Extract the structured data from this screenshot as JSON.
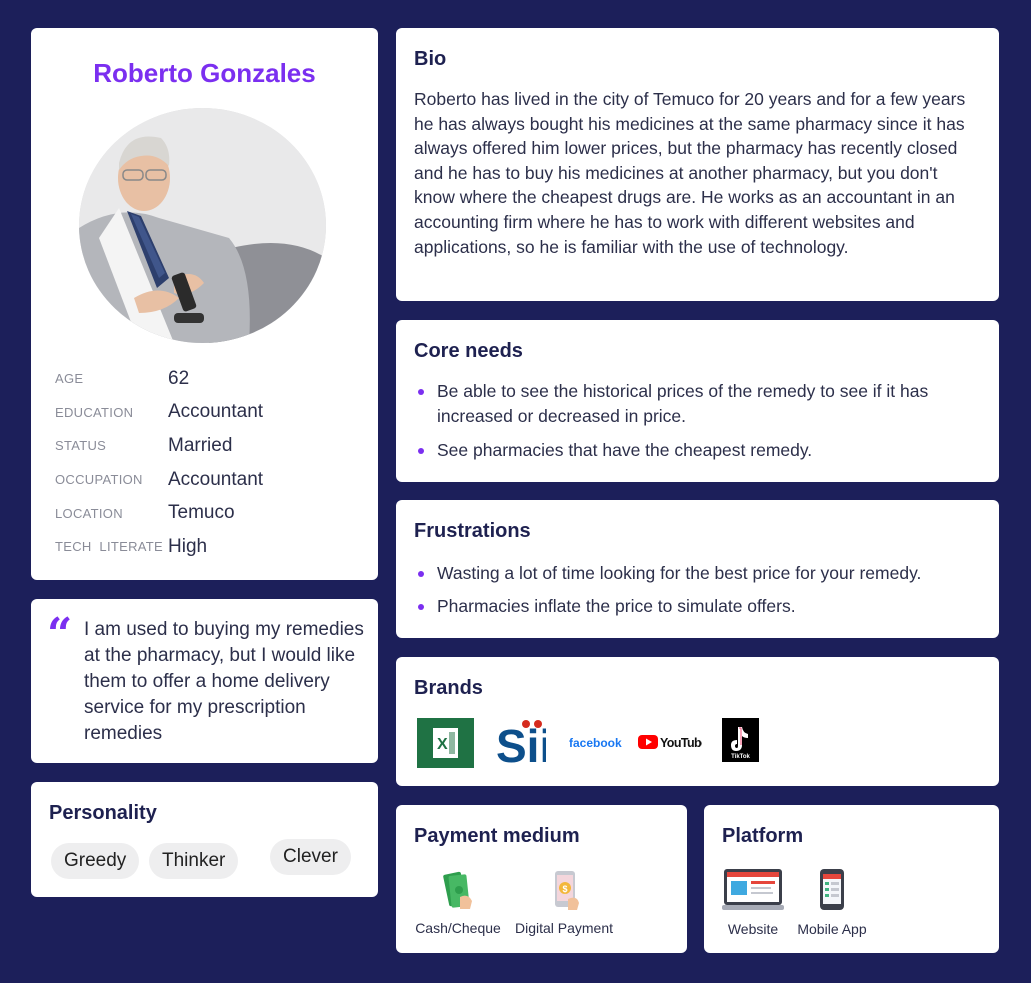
{
  "profile": {
    "name": "Roberto Gonzales",
    "facts": [
      {
        "label": "AGE",
        "value": "62"
      },
      {
        "label": "EDUCATION",
        "value": "Accountant"
      },
      {
        "label": "STATUS",
        "value": "Married"
      },
      {
        "label": "OCCUPATION",
        "value": "Accountant"
      },
      {
        "label": "LOCATION",
        "value": "Temuco"
      },
      {
        "label": "TECH  LITERATE",
        "value": "High"
      }
    ]
  },
  "quote": {
    "mark": "“",
    "text": "I am used to buying my remedies at the pharmacy, but I would like them to offer a home delivery service for my prescription remedies"
  },
  "personality": {
    "title": "Personality",
    "traits": [
      "Greedy",
      "Thinker",
      "Clever"
    ]
  },
  "bio": {
    "title": "Bio",
    "text": "Roberto has lived in the city of Temuco for 20 years and for a few years he has always bought his medicines at the same pharmacy since it has always offered him lower prices, but the pharmacy has recently closed and he has to buy his medicines at another pharmacy, but you don't know where the cheapest drugs are. He works as an accountant in an accounting firm where he has to work with different websites and applications, so he is familiar with the use of technology."
  },
  "core_needs": {
    "title": "Core needs",
    "items": [
      "Be able to see the historical prices of the remedy to see if it has increased or decreased in price.",
      "See pharmacies that have the cheapest remedy."
    ]
  },
  "frustrations": {
    "title": "Frustrations",
    "items": [
      "Wasting a lot of time looking for the best price for your remedy.",
      "Pharmacies inflate the price to simulate offers."
    ]
  },
  "brands": {
    "title": "Brands",
    "logos": [
      {
        "icon": "excel-logo-icon",
        "text": "X"
      },
      {
        "icon": "sii-logo-icon",
        "text": "Sii"
      },
      {
        "icon": "facebook-logo-icon",
        "text": "facebook"
      },
      {
        "icon": "youtube-logo-icon",
        "text": "YouTube"
      },
      {
        "icon": "tiktok-logo-icon",
        "text": "TikTok"
      }
    ]
  },
  "payment": {
    "title": "Payment medium",
    "items": [
      {
        "icon": "cash-icon",
        "label": "Cash/Cheque"
      },
      {
        "icon": "digital-payment-icon",
        "label": "Digital Payment"
      }
    ]
  },
  "platform": {
    "title": "Platform",
    "items": [
      {
        "icon": "website-icon",
        "label": "Website"
      },
      {
        "icon": "mobile-app-icon",
        "label": "Mobile App"
      }
    ]
  },
  "colors": {
    "background": "#1c1f5a",
    "accent": "#7b2ff0",
    "heading": "#1e2150"
  }
}
